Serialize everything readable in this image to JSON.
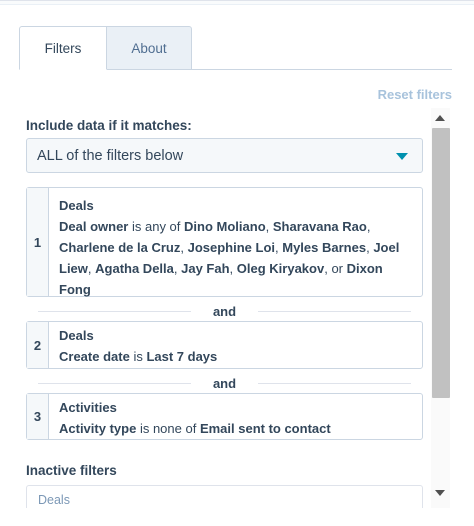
{
  "tabs": [
    {
      "label": "Filters",
      "active": true
    },
    {
      "label": "About",
      "active": false
    }
  ],
  "reset_filters": "Reset filters",
  "include": {
    "label": "Include data if it matches:",
    "selected": "ALL of the filters below"
  },
  "filters": [
    {
      "number": "1",
      "object": "Deals",
      "property": "Deal owner",
      "operator": "is any of",
      "values": [
        {
          "text": "Dino Moliano",
          "sep": ", "
        },
        {
          "text": "Sharavana Rao",
          "sep": ", "
        },
        {
          "text": "Charlene de la Cruz",
          "sep": ", "
        },
        {
          "text": "Josephine Loi",
          "sep": ", "
        },
        {
          "text": "Myles Barnes",
          "sep": ", "
        },
        {
          "text": "Joel Liew",
          "sep": ", "
        },
        {
          "text": "Agatha Della",
          "sep": ", "
        },
        {
          "text": "Jay Fah",
          "sep": ", "
        },
        {
          "text": "Oleg Kiryakov",
          "sep": ", or "
        },
        {
          "text": "Dixon Fong",
          "sep": ""
        }
      ]
    },
    {
      "number": "2",
      "object": "Deals",
      "property": "Create date",
      "operator": "is",
      "values": [
        {
          "text": "Last 7 days",
          "sep": ""
        }
      ]
    },
    {
      "number": "3",
      "object": "Activities",
      "property": "Activity type",
      "operator": "is none of",
      "values": [
        {
          "text": "Email sent to contact",
          "sep": ""
        }
      ]
    }
  ],
  "and_label": "and",
  "inactive": {
    "label": "Inactive filters",
    "first_object": "Deals"
  },
  "colors": {
    "accent": "#0091ae",
    "text": "#33475b",
    "reset_link": "#a8c3dc",
    "border": "#cbd6e2"
  }
}
